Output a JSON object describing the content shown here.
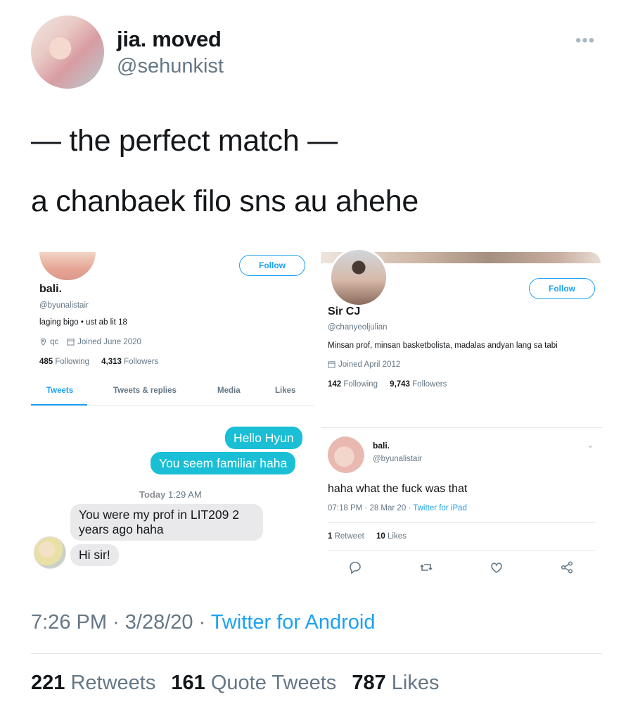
{
  "tweet": {
    "display_name": "jia. moved",
    "handle": "@sehunkist",
    "more_icon": "more-horizontal-icon",
    "line1": "— the perfect match —",
    "line2": "a chanbaek filo sns au ahehe",
    "time": "7:26 PM · 3/28/20 · ",
    "source": "Twitter for Android",
    "stats": {
      "retweets": "221",
      "retweets_label": "Retweets",
      "quotes": "161",
      "quotes_label": "Quote Tweets",
      "likes": "787",
      "likes_label": "Likes"
    }
  },
  "left_image": {
    "follow_label": "Follow",
    "name": "bali.",
    "handle": "@byunalistair",
    "bio": "laging bigo • ust ab lit 18",
    "location": "qc",
    "joined": "Joined June 2020",
    "following_count": "485",
    "following_label": "Following",
    "followers_count": "4,313",
    "followers_label": "Followers",
    "tabs": [
      "Tweets",
      "Tweets & replies",
      "Media",
      "Likes"
    ],
    "chat": {
      "sent1": "Hello Hyun",
      "sent2": "You seem familiar haha",
      "time_day": "Today",
      "time_clock": "1:29 AM",
      "recv1": "You were my prof in LIT209 2 years ago haha",
      "recv2": "Hi sir!"
    }
  },
  "right_image": {
    "follow_label": "Follow",
    "name": "Sir CJ",
    "handle": "@chanyeoljulian",
    "bio": "Minsan prof, minsan basketbolista, madalas andyan lang sa tabi",
    "joined": "Joined April 2012",
    "following_count": "142",
    "following_label": "Following",
    "followers_count": "9,743",
    "followers_label": "Followers",
    "tweet": {
      "name": "bali.",
      "handle": "@byunalistair",
      "text": "haha what the fuck was that",
      "meta": "07:18 PM · 28 Mar 20 · ",
      "source": "Twitter for iPad",
      "retweet_count": "1",
      "retweet_label": "Retweet",
      "likes_count": "10",
      "likes_label": "Likes"
    }
  },
  "colors": {
    "accent": "#1da1f2",
    "imessage_blue": "#1abfd6",
    "gray_text": "#657786"
  }
}
